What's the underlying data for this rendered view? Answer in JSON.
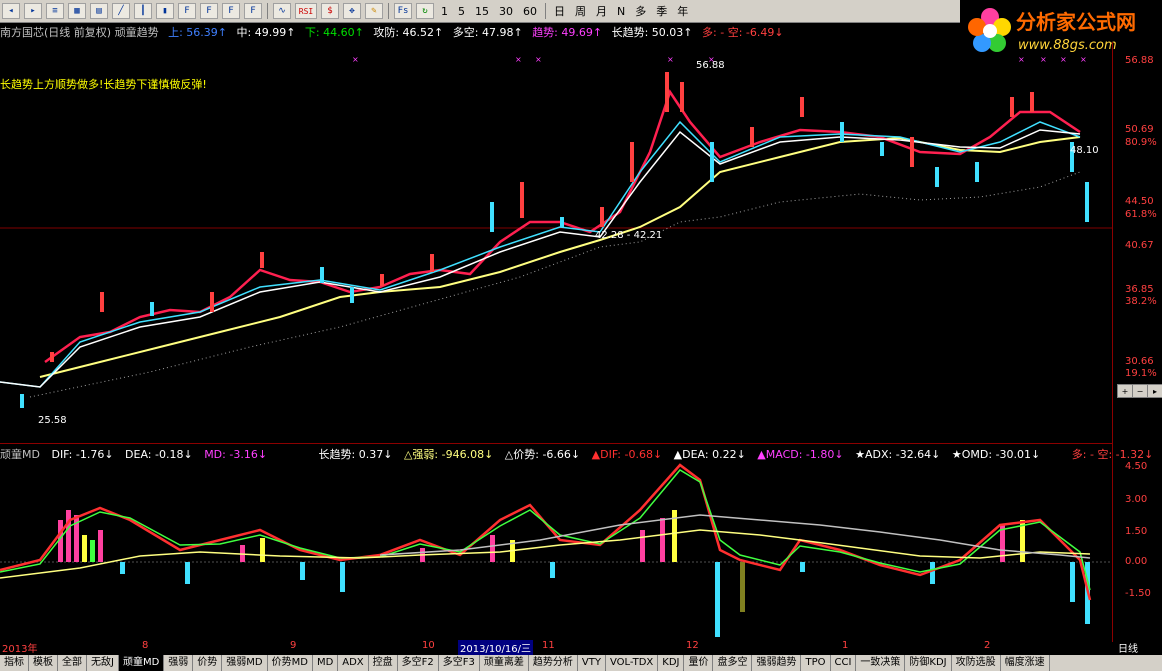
{
  "toolbar": {
    "periods": [
      "1",
      "5",
      "15",
      "30",
      "60"
    ],
    "ranges": [
      "日",
      "周",
      "月",
      "N",
      "多",
      "季",
      "年"
    ],
    "icons": [
      "RSI"
    ]
  },
  "logo": {
    "title": "分析家公式网",
    "url": "www.88gs.com"
  },
  "status": {
    "title": "南方国芯(日线 前复权) 顽童趋势",
    "up": "上: 56.39↑",
    "mid": "中: 49.99↑",
    "down": "下: 44.60↑",
    "attack": "攻防: 46.52↑",
    "longshort": "多空: 47.98↑",
    "trend": "趋势: 49.69↑",
    "longtrend": "长趋势: 50.03↑",
    "duo": "多: - 空: -6.49↓"
  },
  "note": "长趋势上方顺势做多!长趋势下谨慎做反弹!",
  "price_labels": {
    "high": "56.88",
    "low": "25.58",
    "mark1": "48.10",
    "mark2": "42.28 - 42.21"
  },
  "y_main": [
    {
      "v": "56.88"
    },
    {
      "v": "50.69"
    },
    {
      "v": "80.9%"
    },
    {
      "v": "44.50"
    },
    {
      "v": "61.8%"
    },
    {
      "v": "40.67"
    },
    {
      "v": "36.85"
    },
    {
      "v": "38.2%"
    },
    {
      "v": "30.66"
    },
    {
      "v": "19.1%"
    }
  ],
  "y_ind": [
    {
      "v": "4.50"
    },
    {
      "v": "3.00"
    },
    {
      "v": "1.50"
    },
    {
      "v": "0.00"
    },
    {
      "v": "-1.50"
    }
  ],
  "ind": {
    "name": "顽童MD",
    "dif": "DIF: -1.76↓",
    "dea": "DEA: -0.18↓",
    "md": "MD: -3.16↓",
    "ltrend": "长趋势: 0.37↓",
    "strong": "△强弱: -946.08↓",
    "price": "△价势: -6.66↓",
    "dif2": "▲DIF: -0.68↓",
    "dea2": "▲DEA: 0.22↓",
    "macd": "▲MACD: -1.80↓",
    "adx": "★ADX: -32.64↓",
    "omd": "★OMD: -30.01↓",
    "duo": "多: - 空: -1.32↓"
  },
  "dates": [
    {
      "label": "2013年"
    },
    {
      "label": "8"
    },
    {
      "label": "9"
    },
    {
      "label": "10"
    },
    {
      "label": "2013/10/16/三"
    },
    {
      "label": "11"
    },
    {
      "label": "12"
    },
    {
      "label": "1"
    },
    {
      "label": "2"
    }
  ],
  "period_label": "日线",
  "tabs": [
    "指标",
    "模板",
    "全部",
    "无敌J",
    "顽童MD",
    "强弱",
    "价势",
    "强弱MD",
    "价势MD",
    "MD",
    "ADX",
    "控盘",
    "多空F2",
    "多空F3",
    "顽童离差",
    "趋势分析",
    "VTY",
    "VOL-TDX",
    "KDJ",
    "量价",
    "盘多空",
    "强弱趋势",
    "TPO",
    "CCI",
    "一致决策",
    "防御KDJ",
    "攻防选股",
    "幅度涨速"
  ]
}
